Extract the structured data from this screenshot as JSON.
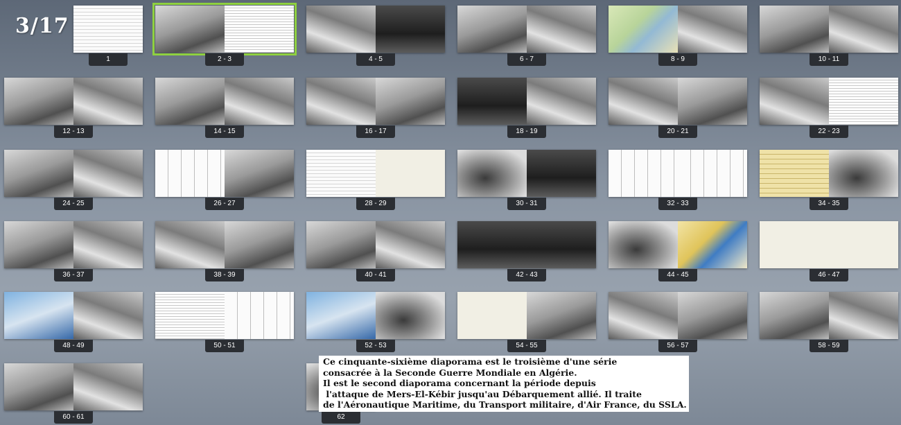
{
  "header": {
    "page_counter": "3/17"
  },
  "slides": [
    {
      "label": "1",
      "left": "docw",
      "right": "",
      "single": true
    },
    {
      "label": "2 - 3",
      "left": "photo",
      "right": "doc",
      "selected": true
    },
    {
      "label": "4 - 5",
      "left": "photo2",
      "right": "dark"
    },
    {
      "label": "6 - 7",
      "left": "photo",
      "right": "photo2"
    },
    {
      "label": "8 - 9",
      "left": "map",
      "right": "photo2"
    },
    {
      "label": "10 - 11",
      "left": "photo",
      "right": "photo2"
    },
    {
      "label": "12 - 13",
      "left": "photo",
      "right": "photo2"
    },
    {
      "label": "14 - 15",
      "left": "photo",
      "right": "photo2"
    },
    {
      "label": "16 - 17",
      "left": "photo2",
      "right": "photo"
    },
    {
      "label": "18 - 19",
      "left": "dark",
      "right": "photo2"
    },
    {
      "label": "20 - 21",
      "left": "photo2",
      "right": "photo"
    },
    {
      "label": "22 - 23",
      "left": "photo2",
      "right": "doc"
    },
    {
      "label": "24 - 25",
      "left": "photo",
      "right": "photo2"
    },
    {
      "label": "26 - 27",
      "left": "ledger",
      "right": "photo"
    },
    {
      "label": "28 - 29",
      "left": "docw",
      "right": "env"
    },
    {
      "label": "30 - 31",
      "left": "photo3",
      "right": "dark"
    },
    {
      "label": "32 - 33",
      "left": "ledger",
      "right": "ledger"
    },
    {
      "label": "34 - 35",
      "left": "yellow",
      "right": "photo3"
    },
    {
      "label": "36 - 37",
      "left": "photo",
      "right": "photo2"
    },
    {
      "label": "38 - 39",
      "left": "photo2",
      "right": "photo"
    },
    {
      "label": "40 - 41",
      "left": "photo",
      "right": "photo2"
    },
    {
      "label": "42 - 43",
      "left": "dark",
      "right": "dark"
    },
    {
      "label": "44 - 45",
      "left": "photo3",
      "right": "stamps"
    },
    {
      "label": "46 - 47",
      "left": "env",
      "right": "env"
    },
    {
      "label": "48 - 49",
      "left": "color",
      "right": "photo2"
    },
    {
      "label": "50 - 51",
      "left": "doc",
      "right": "ledger"
    },
    {
      "label": "52 - 53",
      "left": "color",
      "right": "photo3"
    },
    {
      "label": "54 - 55",
      "left": "env",
      "right": "photo"
    },
    {
      "label": "56 - 57",
      "left": "photo2",
      "right": "photo"
    },
    {
      "label": "58 - 59",
      "left": "photo",
      "right": "photo2"
    },
    {
      "label": "60 - 61",
      "left": "photo",
      "right": "photo2"
    },
    {
      "label": "62",
      "left": "photo3",
      "right": "",
      "single": true
    }
  ],
  "description": {
    "lines": [
      "Ce cinquante-sixième diaporama est le troisième d'une série",
      "consacrée à la Seconde Guerre Mondiale en Algérie.",
      "Il est le second diaporama concernant la période depuis",
      " l'attaque de Mers-El-Kébir jusqu'au Débarquement allié. Il traite",
      "de l'Aéronautique Maritime, du Transport militaire, d'Air France, du SSLA."
    ]
  }
}
